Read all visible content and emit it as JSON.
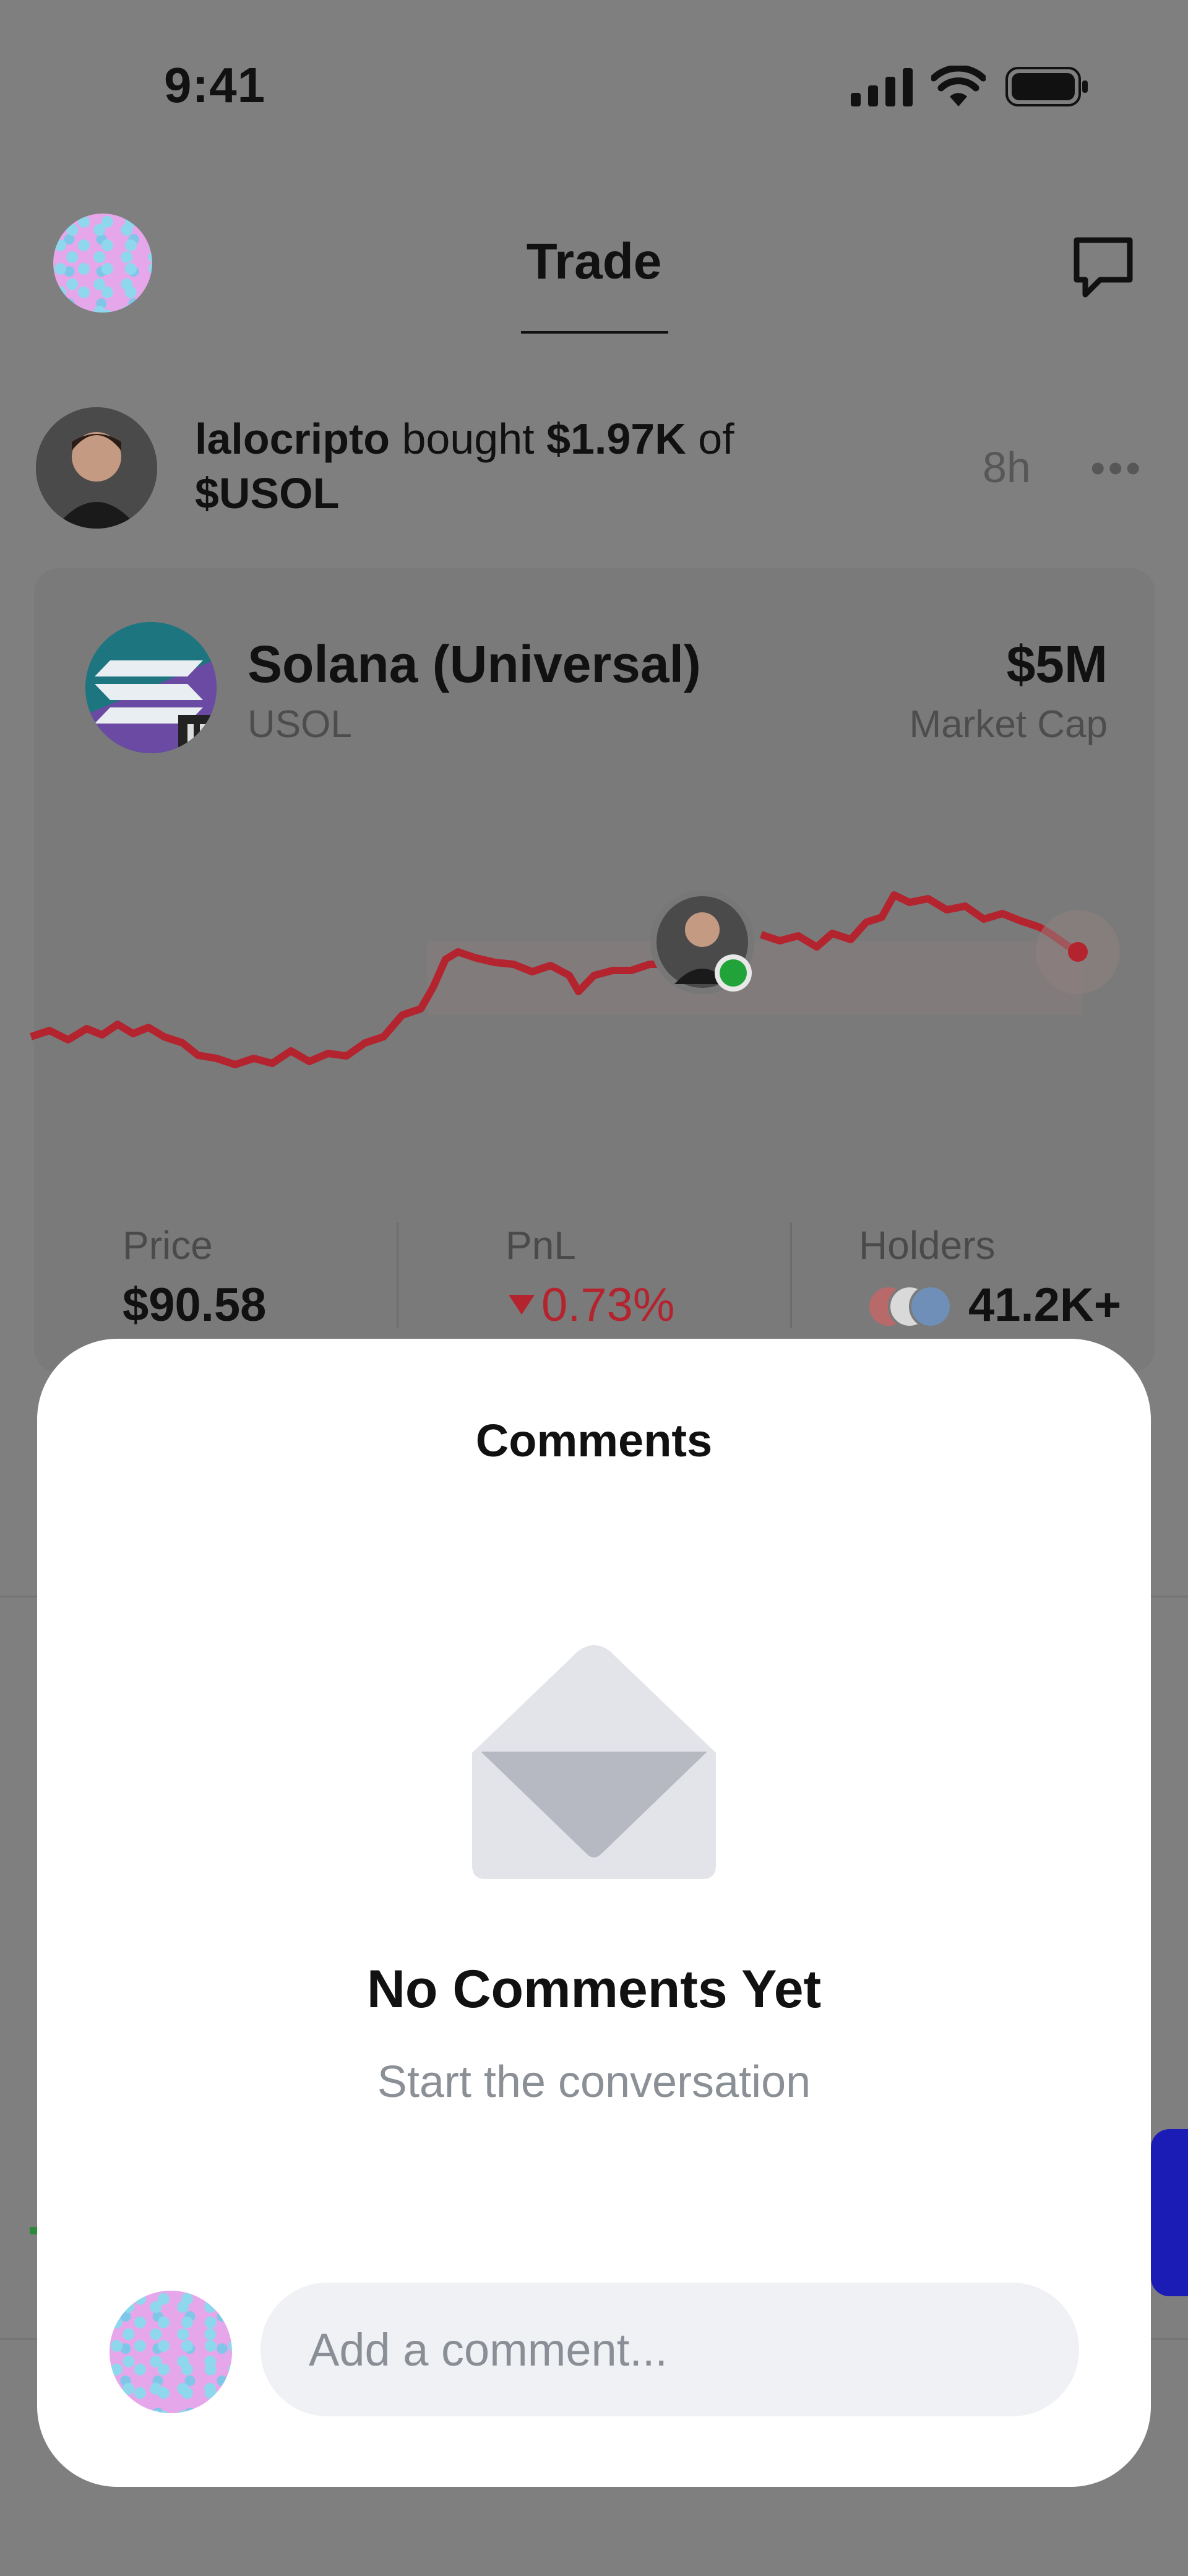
{
  "status_bar": {
    "time": "9:41"
  },
  "header": {
    "title": "Trade"
  },
  "feed": {
    "user": "lalocripto",
    "action": "bought",
    "amount": "$1.97K",
    "preposition": "of",
    "ticker": "$USOL",
    "time_ago": "8h",
    "more": "•••"
  },
  "coin": {
    "name": "Solana (Universal)",
    "symbol": "USOL",
    "market_cap_value": "$5M",
    "market_cap_label": "Market Cap"
  },
  "stats": {
    "price_label": "Price",
    "price_value": "$90.58",
    "pnl_label": "PnL",
    "pnl_value": "0.73%",
    "holders_label": "Holders",
    "holders_value": "41.2K+"
  },
  "colors": {
    "chart_line": "#b3242f",
    "pnl_negative": "#b3242f",
    "online_dot": "#22a33a",
    "accent_blue": "#1b1bb5"
  },
  "comments_sheet": {
    "title": "Comments",
    "empty_title": "No Comments Yet",
    "empty_subtitle": "Start the conversation",
    "input_placeholder": "Add a comment..."
  }
}
